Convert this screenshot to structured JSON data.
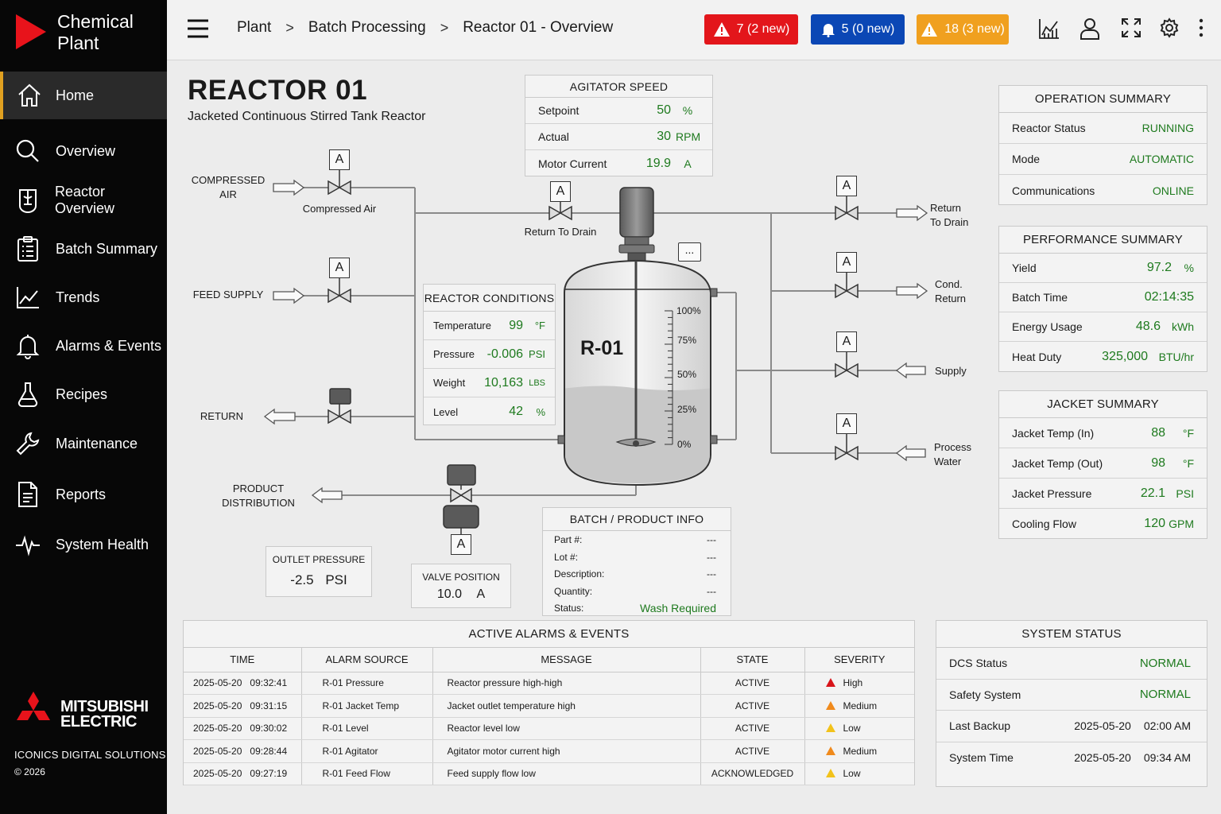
{
  "brand": {
    "line1": "Chemical",
    "line2": "Plant",
    "logo_color": "#e8131b"
  },
  "sidebar": {
    "items": [
      {
        "label": "Home",
        "icon": "home-icon"
      },
      {
        "label": "Overview",
        "icon": "search-icon"
      },
      {
        "label": "Reactor Overview",
        "icon": "reactor-icon"
      },
      {
        "label": "Batch Summary",
        "icon": "clipboard-icon"
      },
      {
        "label": "Trends",
        "icon": "trend-icon"
      },
      {
        "label": "Alarms & Events",
        "icon": "bell-icon"
      },
      {
        "label": "Recipes",
        "icon": "flask-icon"
      },
      {
        "label": "Maintenance",
        "icon": "wrench-icon"
      },
      {
        "label": "Reports",
        "icon": "document-icon"
      },
      {
        "label": "System Health",
        "icon": "pulse-icon"
      }
    ],
    "active_index": 0,
    "company_line1": "MITSUBISHI",
    "company_line2": "ELECTRIC",
    "footer_line1": "ICONICS DIGITAL SOLUTIONS",
    "footer_line2": "© 2026"
  },
  "header": {
    "breadcrumb": [
      "Plant",
      "Batch Processing",
      "Reactor 01 - Overview"
    ],
    "badges": [
      {
        "label": "7 (2 new)",
        "color": "#e3161b",
        "icon": "warning-icon"
      },
      {
        "label": "5 (0 new)",
        "color": "#0b47b5",
        "icon": "bell-icon"
      },
      {
        "label": "18 (3 new)",
        "color": "#f0a01f",
        "icon": "warning-icon"
      }
    ]
  },
  "reactor": {
    "title": "REACTOR 01",
    "subtitle": "Jacketed Continuous Stirred Tank Reactor",
    "vessel_label": "R-01",
    "more_button": "...",
    "level_scale": [
      "100%",
      "75%",
      "50%",
      "25%",
      "0%"
    ],
    "level_fraction": 0.42
  },
  "agitator": {
    "title": "AGITATOR SPEED",
    "rows": [
      {
        "label": "Setpoint",
        "value": "50",
        "unit": "%"
      },
      {
        "label": "Actual",
        "value": "30",
        "unit": "RPM"
      },
      {
        "label": "Motor Current",
        "value": "19.9",
        "unit": "A"
      }
    ]
  },
  "conditions": {
    "title": "REACTOR CONDITIONS",
    "rows": [
      {
        "label": "Temperature",
        "value": "99",
        "unit": "°F"
      },
      {
        "label": "Pressure",
        "value": "-0.006",
        "unit": "PSI"
      },
      {
        "label": "Weight",
        "value": "10,163",
        "unit": "LBS"
      },
      {
        "label": "Level",
        "value": "42",
        "unit": "%"
      }
    ]
  },
  "piping": {
    "compressed_air": "COMPRESSED\nAIR",
    "compressed_air_valve": "Compressed Air",
    "feed_supply": "FEED SUPPLY",
    "return": "RETURN",
    "product_distribution": "PRODUCT\nDISTRIBUTION",
    "return_to_drain_valve": "Return To Drain",
    "right_return_drain": "Return\nTo Drain",
    "right_cond_return": "Cond.\nReturn",
    "right_supply": "Supply",
    "right_process_water": "Process\nWater",
    "tag": "A"
  },
  "outlet_pressure": {
    "title": "OUTLET PRESSURE",
    "value": "-2.5",
    "unit": "PSI"
  },
  "valve_position": {
    "title": "VALVE POSITION",
    "value": "10.0",
    "unit": "A"
  },
  "batch_info": {
    "title": "BATCH / PRODUCT INFO",
    "rows": [
      {
        "label": "Part #:",
        "value": "---"
      },
      {
        "label": "Lot #:",
        "value": "---"
      },
      {
        "label": "Description:",
        "value": "---"
      },
      {
        "label": "Quantity:",
        "value": "---"
      },
      {
        "label": "Status:",
        "value": "Wash Required"
      }
    ]
  },
  "operation_summary": {
    "title": "OPERATION SUMMARY",
    "rows": [
      {
        "label": "Reactor Status",
        "value": "RUNNING"
      },
      {
        "label": "Mode",
        "value": "AUTOMATIC"
      },
      {
        "label": "Communications",
        "value": "ONLINE"
      }
    ]
  },
  "performance_summary": {
    "title": "PERFORMANCE SUMMARY",
    "rows": [
      {
        "label": "Yield",
        "value": "97.2",
        "unit": "%"
      },
      {
        "label": "Batch Time",
        "value": "02:14:35",
        "unit": ""
      },
      {
        "label": "Energy Usage",
        "value": "48.6",
        "unit": "kWh"
      },
      {
        "label": "Heat Duty",
        "value": "325,000",
        "unit": "BTU/hr"
      }
    ]
  },
  "jacket_summary": {
    "title": "JACKET SUMMARY",
    "rows": [
      {
        "label": "Jacket Temp (In)",
        "value": "88",
        "unit": "°F"
      },
      {
        "label": "Jacket Temp (Out)",
        "value": "98",
        "unit": "°F"
      },
      {
        "label": "Jacket Pressure",
        "value": "22.1",
        "unit": "PSI"
      },
      {
        "label": "Cooling Flow",
        "value": "120",
        "unit": "GPM"
      }
    ]
  },
  "alarms": {
    "title": "ACTIVE ALARMS & EVENTS",
    "columns": [
      "TIME",
      "ALARM SOURCE",
      "MESSAGE",
      "STATE",
      "SEVERITY"
    ],
    "rows": [
      {
        "date": "2025-05-20",
        "time": "09:32:41",
        "source": "R-01 Pressure",
        "message": "Reactor pressure high-high",
        "state": "ACTIVE",
        "severity": "High",
        "sev_color": "#d8141a"
      },
      {
        "date": "2025-05-20",
        "time": "09:31:15",
        "source": "R-01 Jacket Temp",
        "message": "Jacket outlet temperature high",
        "state": "ACTIVE",
        "severity": "Medium",
        "sev_color": "#f08a1c"
      },
      {
        "date": "2025-05-20",
        "time": "09:30:02",
        "source": "R-01 Level",
        "message": "Reactor level low",
        "state": "ACTIVE",
        "severity": "Low",
        "sev_color": "#f2c21b"
      },
      {
        "date": "2025-05-20",
        "time": "09:28:44",
        "source": "R-01 Agitator",
        "message": "Agitator motor current high",
        "state": "ACTIVE",
        "severity": "Medium",
        "sev_color": "#f08a1c"
      },
      {
        "date": "2025-05-20",
        "time": "09:27:19",
        "source": "R-01 Feed Flow",
        "message": "Feed supply flow low",
        "state": "ACKNOWLEDGED",
        "severity": "Low",
        "sev_color": "#f2c21b"
      }
    ]
  },
  "system_status": {
    "title": "SYSTEM STATUS",
    "rows": [
      {
        "label": "DCS Status",
        "value": "NORMAL"
      },
      {
        "label": "Safety System",
        "value": "NORMAL"
      },
      {
        "label": "Last Backup",
        "date": "2025-05-20",
        "time": "02:00 AM"
      },
      {
        "label": "System Time",
        "date": "2025-05-20",
        "time": "09:34 AM"
      }
    ]
  }
}
